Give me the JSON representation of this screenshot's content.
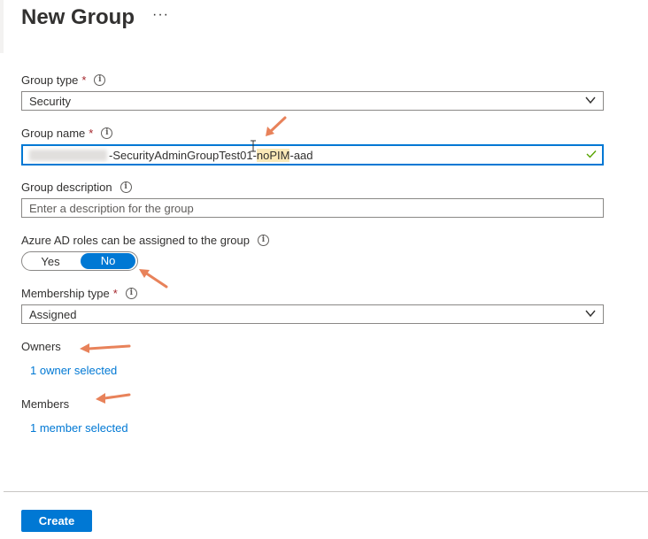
{
  "page": {
    "title": "New Group",
    "more_label": "···"
  },
  "group_type": {
    "label": "Group type",
    "required": "*",
    "value": "Security"
  },
  "group_name": {
    "label": "Group name",
    "required": "*",
    "value_main": "-SecurityAdminGroupTest01-",
    "value_highlight": "noPIM",
    "value_tail": "-aad"
  },
  "group_description": {
    "label": "Group description",
    "placeholder": "Enter a description for the group"
  },
  "azure_roles": {
    "label": "Azure AD roles can be assigned to the group",
    "yes": "Yes",
    "no": "No",
    "selected": "No"
  },
  "membership_type": {
    "label": "Membership type",
    "required": "*",
    "value": "Assigned"
  },
  "owners": {
    "label": "Owners",
    "link": "1 owner selected"
  },
  "members": {
    "label": "Members",
    "link": "1 member selected"
  },
  "actions": {
    "create": "Create"
  },
  "colors": {
    "accent": "#0078d4",
    "required": "#a4262c",
    "annotation_arrow": "#e8825a",
    "highlight": "#fbe9b7"
  }
}
